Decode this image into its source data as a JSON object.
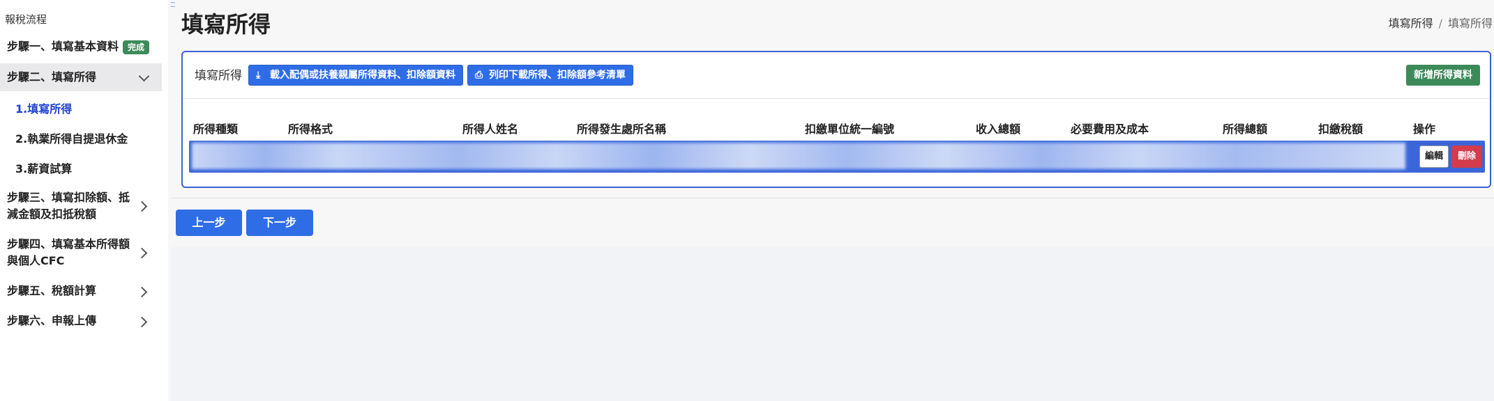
{
  "sidebar": {
    "title": "報稅流程",
    "step1": {
      "label": "步驟一、填寫基本資料",
      "badge": "完成"
    },
    "step2": {
      "label": "步驟二、填寫所得",
      "subitems": [
        "1.填寫所得",
        "2.執業所得自提退休金",
        "3.薪資試算"
      ]
    },
    "step3": {
      "line1": "步驟三、填寫扣除額、抵",
      "line2": "減金額及扣抵稅額"
    },
    "step4": {
      "line1": "步驟四、填寫基本所得額",
      "line2": "與個人CFC"
    },
    "step5": {
      "label": "步驟五、稅額計算"
    },
    "step6": {
      "label": "步驟六、申報上傳"
    }
  },
  "header": {
    "title": "填寫所得",
    "breadcrumb": [
      "填寫所得",
      "填寫所得"
    ],
    "breadcrumb_sep": "/"
  },
  "card": {
    "label": "填寫所得",
    "import_button": "載入配偶或扶養親屬所得資料、扣除額資料",
    "print_button": "列印下載所得、扣除額參考清單",
    "add_button": "新增所得資料",
    "columns": [
      "所得種類",
      "所得格式",
      "所得人姓名",
      "所得發生處所名稱",
      "扣繳單位統一編號",
      "收入總額",
      "必要費用及成本",
      "所得總額",
      "扣繳稅額",
      "操作"
    ],
    "row_actions": {
      "edit": "編輯",
      "delete": "刪除"
    }
  },
  "nav": {
    "prev": "上一步",
    "next": "下一步"
  },
  "colors": {
    "primary": "#2f6de6",
    "success": "#3c8a59",
    "danger": "#d23c4b"
  }
}
